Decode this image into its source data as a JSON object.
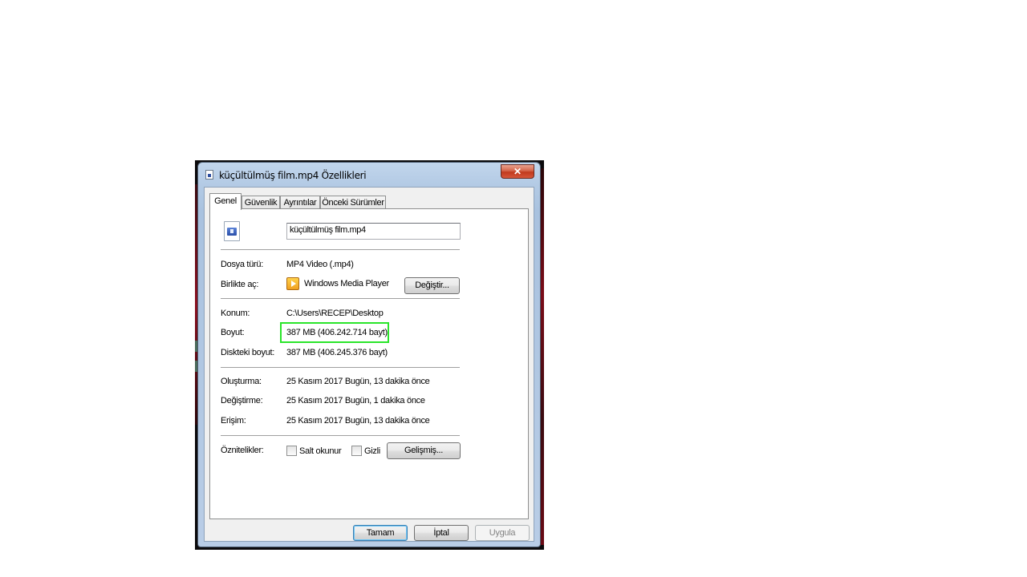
{
  "window": {
    "title": "küçültülmüş film.mp4 Özellikleri",
    "close_glyph": "✕"
  },
  "tabs": [
    {
      "label": "Genel",
      "active": true
    },
    {
      "label": "Güvenlik",
      "active": false
    },
    {
      "label": "Ayrıntılar",
      "active": false
    },
    {
      "label": "Önceki Sürümler",
      "active": false
    }
  ],
  "general": {
    "file_icon": "video-file-icon",
    "file_name": "küçültülmüş film.mp4",
    "type_label": "Dosya türü:",
    "type_value": "MP4 Video (.mp4)",
    "opens_with_label": "Birlikte aç:",
    "opens_with_icon": "windows-media-player-icon",
    "opens_with_value": "Windows Media Player",
    "change_button": "Değiştir...",
    "location_label": "Konum:",
    "location_value": "C:\\Users\\RECEP\\Desktop",
    "size_label": "Boyut:",
    "size_value": "387 MB (406.242.714 bayt)",
    "size_on_disk_label": "Diskteki boyut:",
    "size_on_disk_value": "387 MB (406.245.376 bayt)",
    "created_label": "Oluşturma:",
    "created_value": "25 Kasım 2017 Bugün, 13 dakika önce",
    "modified_label": "Değiştirme:",
    "modified_value": "25 Kasım 2017 Bugün, 1 dakika önce",
    "accessed_label": "Erişim:",
    "accessed_value": "25 Kasım 2017 Bugün, 13 dakika önce",
    "attributes_label": "Öznitelikler:",
    "readonly_label": "Salt okunur",
    "readonly_checked": false,
    "hidden_label": "Gizli",
    "hidden_checked": false,
    "advanced_button": "Gelişmiş..."
  },
  "footer": {
    "ok_button": "Tamam",
    "cancel_button": "İptal",
    "apply_button": "Uygula"
  },
  "colors": {
    "highlight_box": "#2ae52a",
    "close_button": "#c13a1d"
  }
}
